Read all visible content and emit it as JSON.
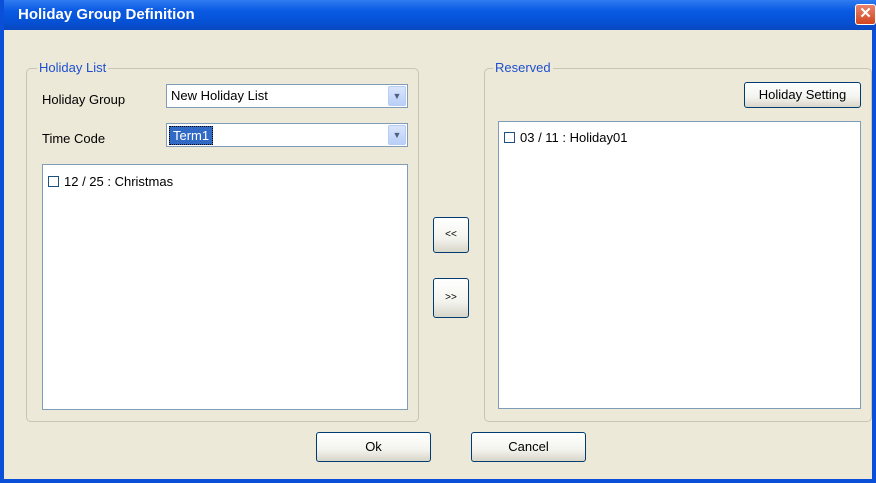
{
  "window": {
    "title": "Holiday Group Definition"
  },
  "holiday_list": {
    "legend": "Holiday List",
    "group_label": "Holiday Group",
    "group_value": "New Holiday List",
    "timecode_label": "Time Code",
    "timecode_value": "Term1",
    "items": [
      {
        "label": "12 / 25 : Christmas",
        "checked": false
      }
    ]
  },
  "move": {
    "left_label": "<<",
    "right_label": ">>"
  },
  "reserved": {
    "legend": "Reserved",
    "setting_button": "Holiday Setting",
    "items": [
      {
        "label": "03 / 11 : Holiday01",
        "checked": false
      }
    ]
  },
  "footer": {
    "ok_label": "Ok",
    "cancel_label": "Cancel"
  }
}
